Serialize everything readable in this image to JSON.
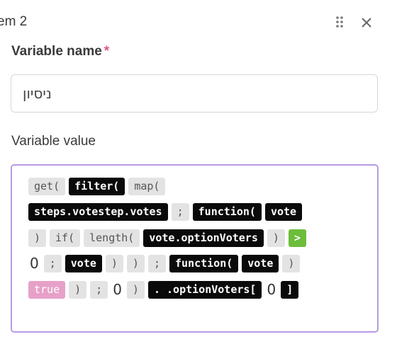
{
  "header": {
    "title": "em 2",
    "drag_icon": "drag-dots-icon",
    "close_icon": "close-icon"
  },
  "variable_name": {
    "label": "Variable name",
    "required_marker": "*",
    "value": "ניסיון"
  },
  "variable_value": {
    "label": "Variable value",
    "lines": [
      [
        {
          "type": "g",
          "text": "get("
        },
        {
          "type": "k",
          "text": "filter("
        },
        {
          "type": "g",
          "text": "map("
        }
      ],
      [
        {
          "type": "k",
          "text": "steps.votestep.votes"
        },
        {
          "type": "g",
          "text": ";"
        },
        {
          "type": "k",
          "text": "function("
        },
        {
          "type": "k",
          "text": "vote"
        }
      ],
      [
        {
          "type": "g",
          "text": ")"
        },
        {
          "type": "g",
          "text": "if("
        },
        {
          "type": "g",
          "text": "length("
        },
        {
          "type": "k",
          "text": "vote.optionVoters"
        },
        {
          "type": "g",
          "text": ")"
        },
        {
          "type": "grn",
          "text": ">"
        }
      ],
      [
        {
          "type": "txt",
          "text": "0"
        },
        {
          "type": "g",
          "text": ";"
        },
        {
          "type": "k",
          "text": "vote"
        },
        {
          "type": "g",
          "text": ")"
        },
        {
          "type": "g",
          "text": ")"
        },
        {
          "type": "g",
          "text": ";"
        },
        {
          "type": "k",
          "text": "function("
        },
        {
          "type": "k",
          "text": "vote"
        },
        {
          "type": "g",
          "text": ")"
        }
      ],
      [
        {
          "type": "pink",
          "text": "true"
        },
        {
          "type": "g",
          "text": ")"
        },
        {
          "type": "g",
          "text": ";"
        },
        {
          "type": "txt",
          "text": "0"
        },
        {
          "type": "g",
          "text": ")"
        },
        {
          "type": "k",
          "text": ". .optionVoters["
        },
        {
          "type": "txt",
          "text": "0"
        },
        {
          "type": "k",
          "text": "]"
        }
      ]
    ]
  },
  "colors": {
    "focus_border": "#b79be5",
    "required": "#e0567a",
    "operator_green": "#6dbd3c",
    "boolean_pink": "#e7a1c8"
  }
}
